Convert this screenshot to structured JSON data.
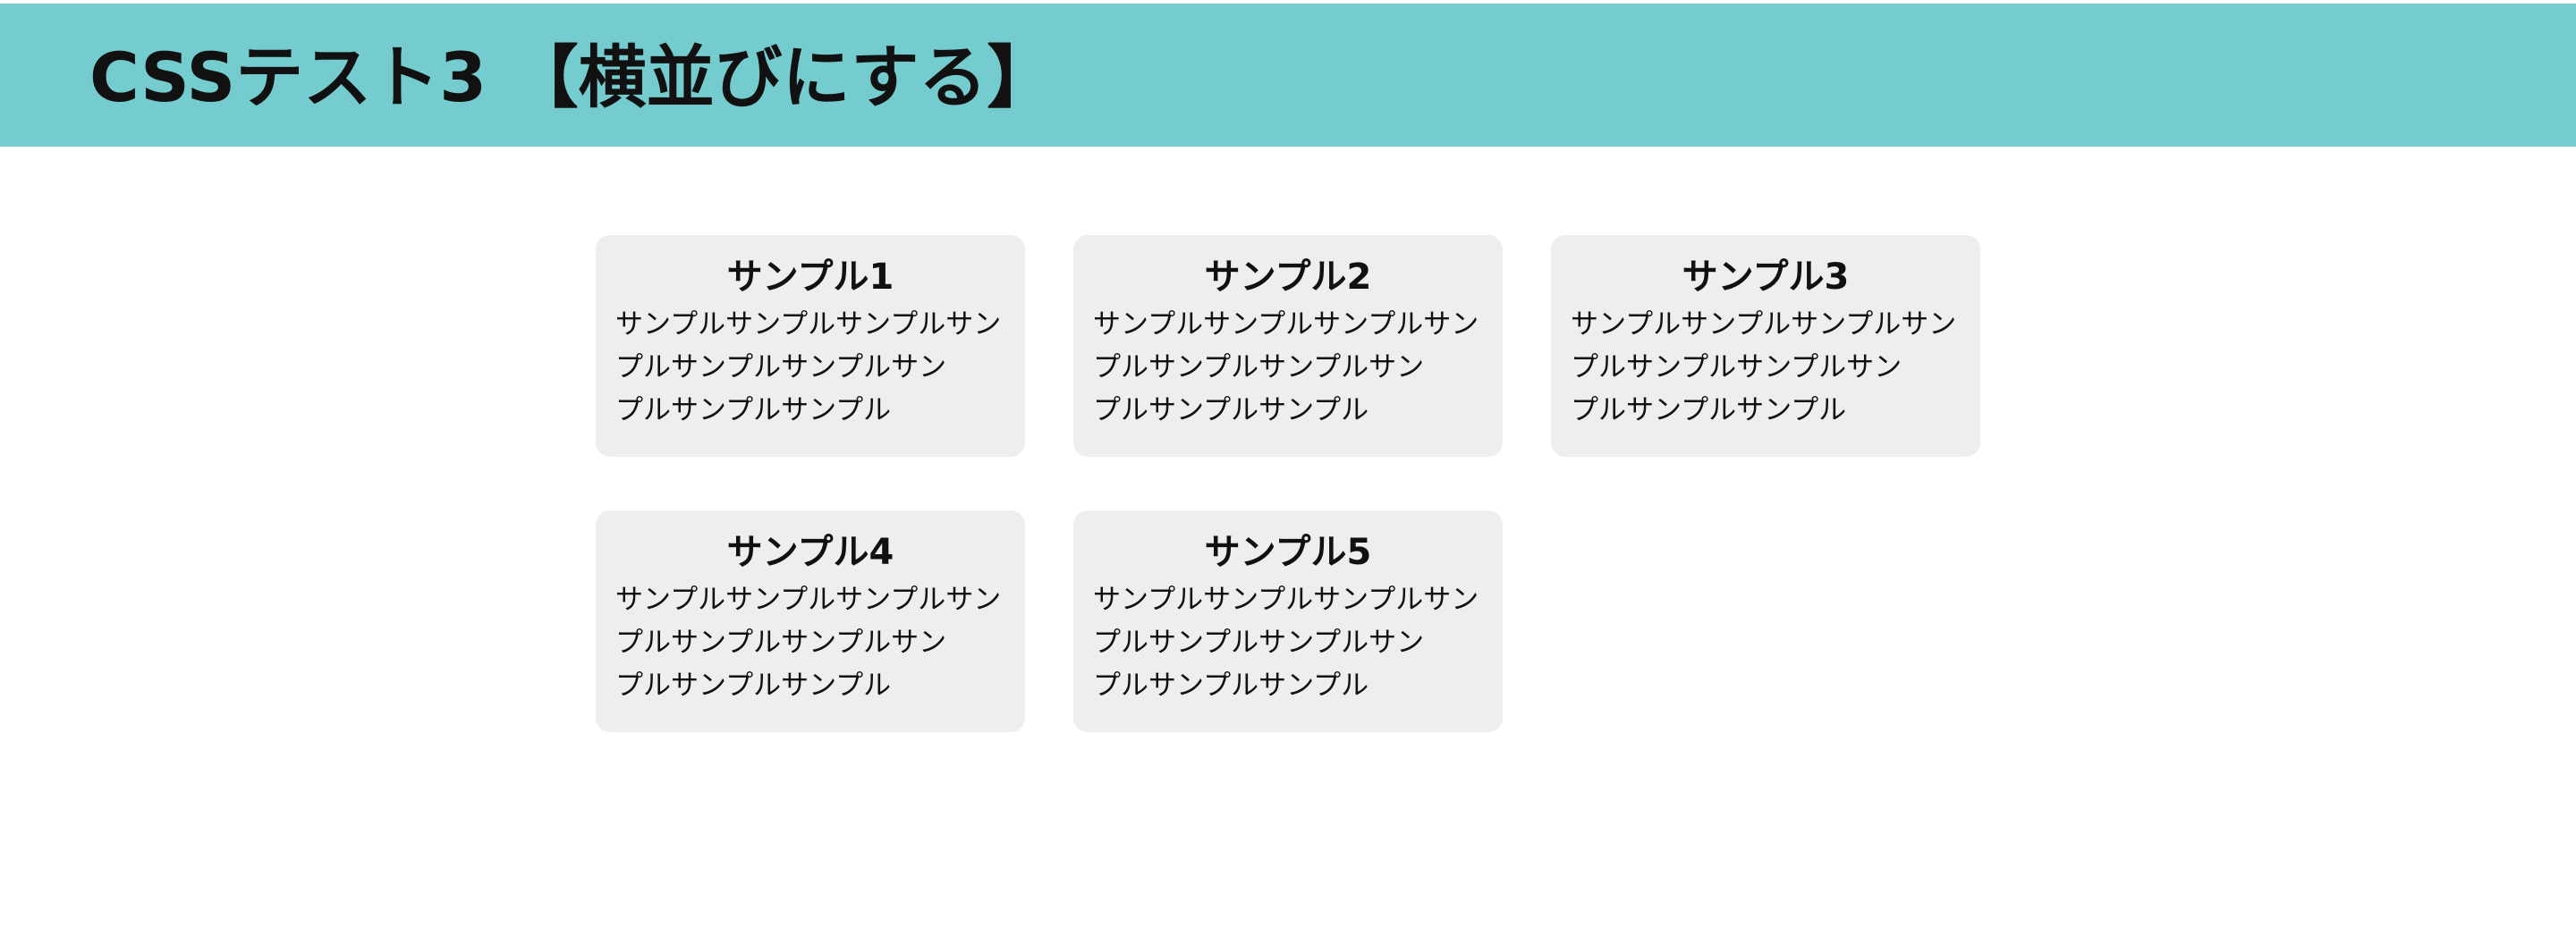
{
  "header": {
    "title": "CSSテスト3 【横並びにする】",
    "background_color": "#74cccf"
  },
  "cards": [
    {
      "title": "サンプル1",
      "body": "サンプルサンプルサンプルサン\nプルサンプルサンプルサン\nプルサンプルサンプル"
    },
    {
      "title": "サンプル2",
      "body": "サンプルサンプルサンプルサン\nプルサンプルサンプルサン\nプルサンプルサンプル"
    },
    {
      "title": "サンプル3",
      "body": "サンプルサンプルサンプルサン\nプルサンプルサンプルサン\nプルサンプルサンプル"
    },
    {
      "title": "サンプル4",
      "body": "サンプルサンプルサンプルサン\nプルサンプルサンプルサン\nプルサンプルサンプル"
    },
    {
      "title": "サンプル5",
      "body": "サンプルサンプルサンプルサン\nプルサンプルサンプルサン\nプルサンプルサンプル"
    }
  ],
  "card_background_color": "#eeeeee"
}
